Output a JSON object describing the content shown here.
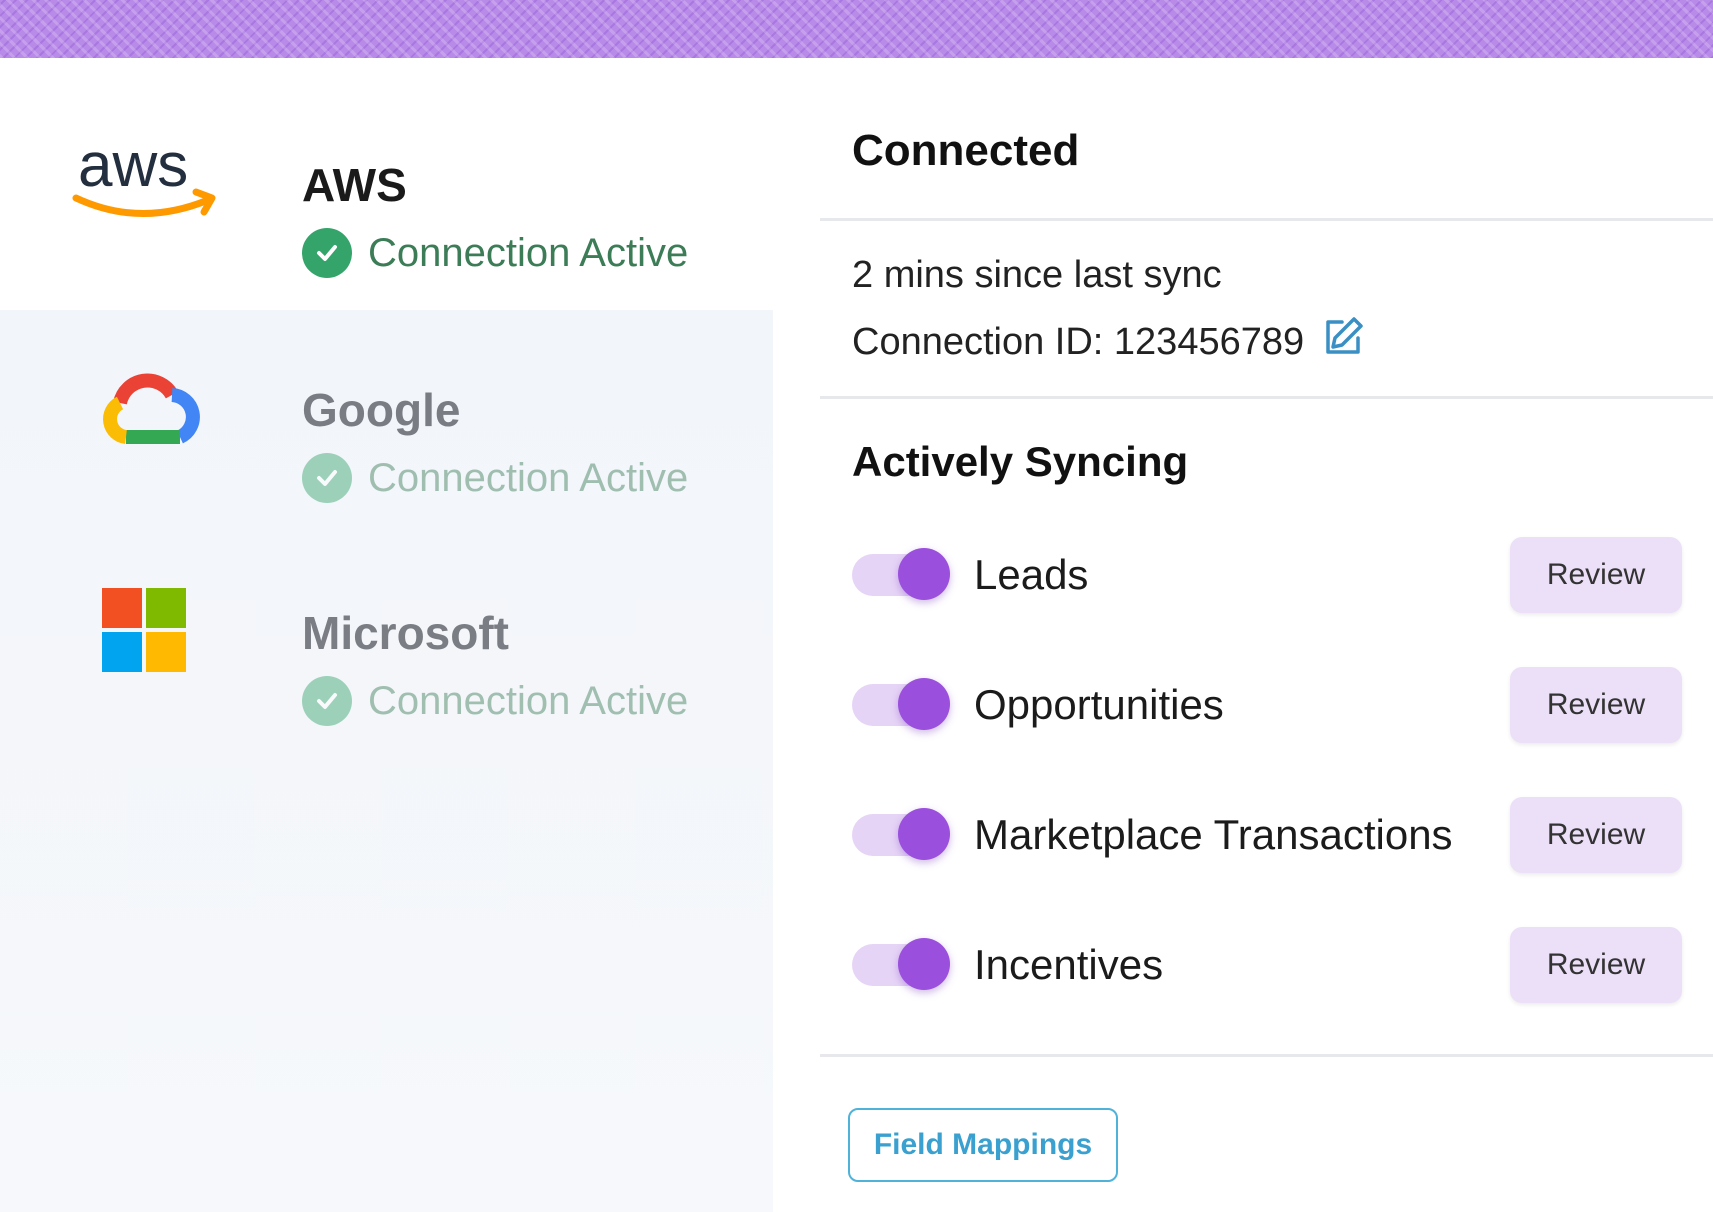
{
  "providers": [
    {
      "name": "AWS",
      "status": "Connection Active",
      "logo_icon": "aws-logo",
      "logo_text": "aws"
    },
    {
      "name": "Google",
      "status": "Connection Active",
      "logo_icon": "google-cloud-logo"
    },
    {
      "name": "Microsoft",
      "status": "Connection Active",
      "logo_icon": "microsoft-logo"
    }
  ],
  "detail": {
    "title": "Connected",
    "last_sync": "2 mins since last sync",
    "connection_id": "Connection ID: 123456789",
    "edit_icon": "edit-icon",
    "section_title": "Actively Syncing",
    "sync_items": [
      {
        "label": "Leads",
        "enabled": true,
        "action": "Review"
      },
      {
        "label": "Opportunities",
        "enabled": true,
        "action": "Review"
      },
      {
        "label": "Marketplace Transactions",
        "enabled": true,
        "action": "Review"
      },
      {
        "label": "Incentives",
        "enabled": true,
        "action": "Review"
      }
    ],
    "field_mappings_label": "Field Mappings"
  },
  "colors": {
    "accent_purple": "#9a4fdd",
    "status_green": "#34a46a",
    "link_blue": "#3aa0cf",
    "banner_purple": "#b98be9"
  }
}
